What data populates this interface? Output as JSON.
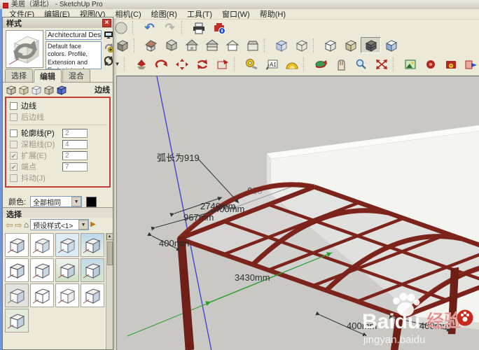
{
  "window": {
    "title": "美居（湖北） - SketchUp Pro"
  },
  "menu": {
    "items": [
      "文件(F)",
      "编辑(E)",
      "视图(V)",
      "相机(C)",
      "绘图(R)",
      "工具(T)",
      "窗口(W)",
      "帮助(H)"
    ]
  },
  "icons": {
    "undo": "↶",
    "redo": "↷",
    "dropdown": "▼",
    "back": "⇦",
    "forward": "⇨",
    "home": "⌂",
    "flyout": "▶",
    "close": "×",
    "scroll_up": "▲",
    "overflow_arrow": "▾"
  },
  "toolbar": {
    "a1_label": "A1"
  },
  "styles_panel": {
    "title": "样式",
    "style_name": "Architectural Design Style",
    "style_desc": "Default face colors. Profile, Extension and Endpoints edges. Light",
    "tabs": [
      "选择",
      "编辑",
      "混合"
    ],
    "edge_label": "边线",
    "edge_rows": [
      {
        "label": "边线",
        "mark": ""
      },
      {
        "label": "后边线",
        "mark": ""
      },
      {
        "label": "轮廓线(P)",
        "mark": "",
        "value": "2"
      },
      {
        "label": "深粗线(D)",
        "mark": "",
        "value": "4"
      },
      {
        "label": "扩展(E)",
        "mark": "✔",
        "value": "2"
      },
      {
        "label": "端点",
        "mark": "✔",
        "value": "7"
      },
      {
        "label": "抖动(J)",
        "mark": ""
      }
    ],
    "color_label": "颜色:",
    "color_value": "全部相同",
    "select_header": "选择",
    "preset_value": "预设样式<1>"
  },
  "viewport": {
    "dims": [
      {
        "text": "弧长为919"
      },
      {
        "text": "2740mm"
      },
      {
        "text": "400mm"
      },
      {
        "text": "967mm"
      },
      {
        "text": "400mm"
      },
      {
        "text": "660"
      },
      {
        "text": "3430mm"
      },
      {
        "text": "400mm"
      },
      {
        "text": "400mm"
      }
    ],
    "watermark": {
      "brand": "Baidu",
      "suffix": "经验",
      "url": "jingyan.baidu"
    }
  },
  "colors": {
    "accent_red_annotation": "#c43c34",
    "beam_maroon": "#7c241b",
    "axis_blue": "#4444cc",
    "axis_green": "#2e9e2e",
    "watermark_red": "#c8281e",
    "viewport_bg": "#c9c8c5"
  }
}
